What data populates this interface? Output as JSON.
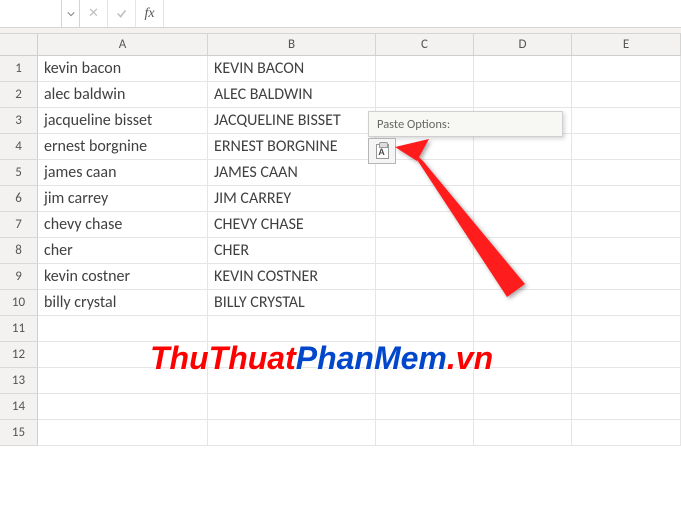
{
  "formula_bar": {
    "name_box": "",
    "formula": "",
    "fx_label": "fx",
    "cancel_char": "✕",
    "enter_char": "✓"
  },
  "columns": [
    "A",
    "B",
    "C",
    "D",
    "E"
  ],
  "rows": [
    {
      "n": "1",
      "a": "kevin bacon",
      "b": "KEVIN BACON"
    },
    {
      "n": "2",
      "a": "alec baldwin",
      "b": "ALEC BALDWIN"
    },
    {
      "n": "3",
      "a": "jacqueline bisset",
      "b": "JACQUELINE BISSET"
    },
    {
      "n": "4",
      "a": "ernest borgnine",
      "b": "ERNEST BORGNINE"
    },
    {
      "n": "5",
      "a": "james caan",
      "b": "JAMES CAAN"
    },
    {
      "n": "6",
      "a": "jim carrey",
      "b": "JIM CARREY"
    },
    {
      "n": "7",
      "a": "chevy chase",
      "b": "CHEVY CHASE"
    },
    {
      "n": "8",
      "a": "cher",
      "b": "CHER"
    },
    {
      "n": "9",
      "a": "kevin costner",
      "b": "KEVIN COSTNER"
    },
    {
      "n": "10",
      "a": "billy crystal",
      "b": "BILLY CRYSTAL"
    },
    {
      "n": "11",
      "a": "",
      "b": ""
    },
    {
      "n": "12",
      "a": "",
      "b": ""
    },
    {
      "n": "13",
      "a": "",
      "b": ""
    },
    {
      "n": "14",
      "a": "",
      "b": ""
    },
    {
      "n": "15",
      "a": "",
      "b": ""
    }
  ],
  "paste_options": {
    "tooltip": "Paste Options:",
    "icon_label": "A"
  },
  "watermark": {
    "part1": "ThuThuat",
    "part2": "PhanMem",
    "part3": ".vn"
  }
}
